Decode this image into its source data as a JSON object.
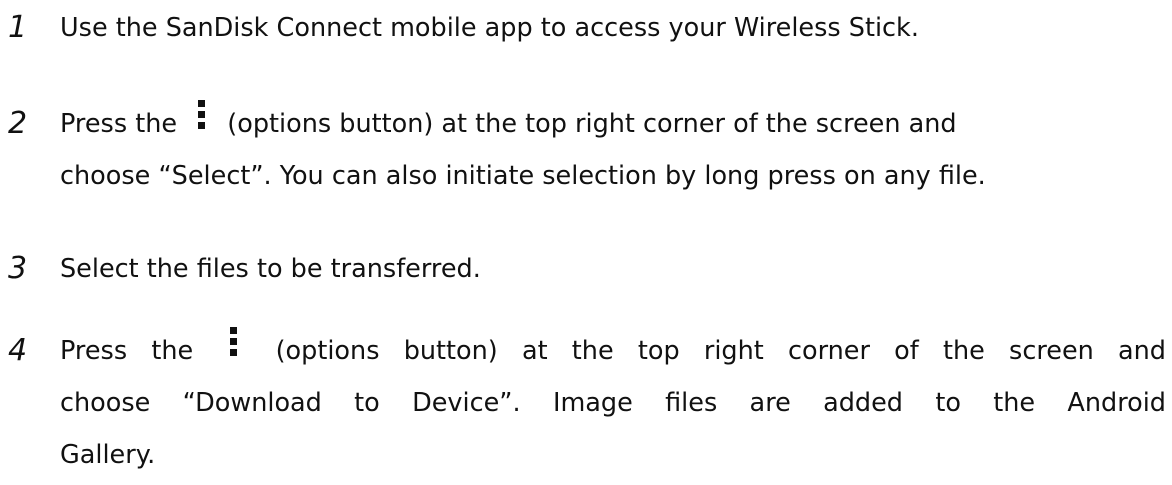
{
  "steps": [
    {
      "number": "1",
      "lines": [
        "Use the SanDisk Connect mobile app to access your Wireless Stick."
      ]
    },
    {
      "number": "2",
      "line1_before": "Press the",
      "line1_after": "(options button) at the top right corner of the screen and",
      "line2": "choose “Select”. You can also initiate selection by long press on any file.",
      "icon": "options-kebab-icon"
    },
    {
      "number": "3",
      "lines": [
        "Select the files to be transferred."
      ]
    },
    {
      "number": "4",
      "line1_before": "Press the",
      "line1_after": "(options button) at the top right corner of the screen and",
      "line2": "choose “Download to Device”. Image files are added to the Android",
      "line3": "Gallery.",
      "icon": "options-kebab-icon"
    }
  ]
}
